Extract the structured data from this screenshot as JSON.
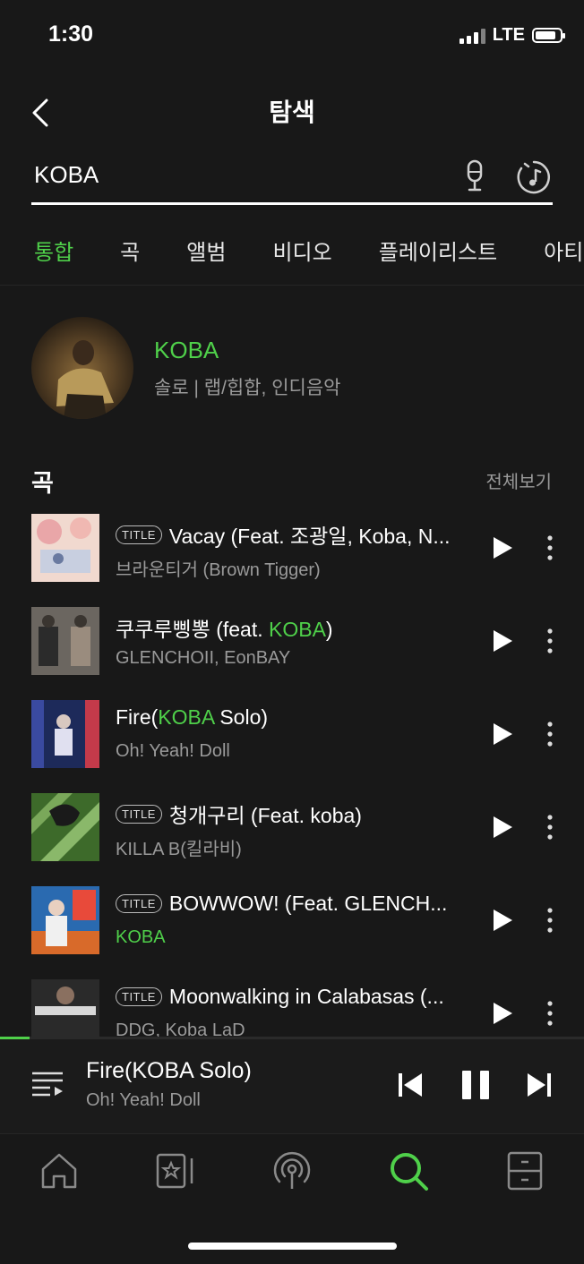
{
  "status": {
    "time": "1:30",
    "network": "LTE"
  },
  "header": {
    "title": "탐색"
  },
  "search": {
    "value": "KOBA",
    "placeholder": ""
  },
  "tabs": [
    {
      "label": "통합",
      "active": true
    },
    {
      "label": "곡",
      "active": false
    },
    {
      "label": "앨범",
      "active": false
    },
    {
      "label": "비디오",
      "active": false
    },
    {
      "label": "플레이리스트",
      "active": false
    },
    {
      "label": "아티",
      "active": false
    }
  ],
  "artist": {
    "name": "KOBA",
    "meta": "솔로 | 랩/힙합, 인디음악"
  },
  "songs_section": {
    "title": "곡",
    "see_all": "전체보기"
  },
  "songs": [
    {
      "badge": "TITLE",
      "title": "Vacay (Feat. 조광일, Koba, N...",
      "artist": "브라운티거 (Brown Tigger)"
    },
    {
      "badge": "",
      "title_pre": "쿠쿠루삥뽕 (feat. ",
      "title_hl": "KOBA",
      "title_post": ")",
      "artist": "GLENCHOII, EonBAY"
    },
    {
      "badge": "",
      "title_pre": "Fire(",
      "title_hl": "KOBA",
      "title_post": " Solo)",
      "artist": "Oh! Yeah! Doll"
    },
    {
      "badge": "TITLE",
      "title": "청개구리 (Feat. koba)",
      "artist": "KILLA B(킬라비)"
    },
    {
      "badge": "TITLE",
      "title": "BOWWOW! (Feat. GLENCH...",
      "artist": "KOBA",
      "artist_hl": true
    },
    {
      "badge": "TITLE",
      "title": "Moonwalking in Calabasas (...",
      "artist": "DDG, Koba LaD"
    }
  ],
  "player": {
    "title": "Fire(KOBA Solo)",
    "artist": "Oh! Yeah! Doll",
    "progress": 0.05
  },
  "colors": {
    "accent": "#4fd04a",
    "background": "#181818",
    "secondary_text": "#9a9a9a"
  },
  "nav": [
    {
      "icon": "home-icon",
      "active": false
    },
    {
      "icon": "library-star-icon",
      "active": false
    },
    {
      "icon": "podcast-icon",
      "active": false
    },
    {
      "icon": "search-icon",
      "active": true
    },
    {
      "icon": "storage-drawer-icon",
      "active": false
    }
  ]
}
